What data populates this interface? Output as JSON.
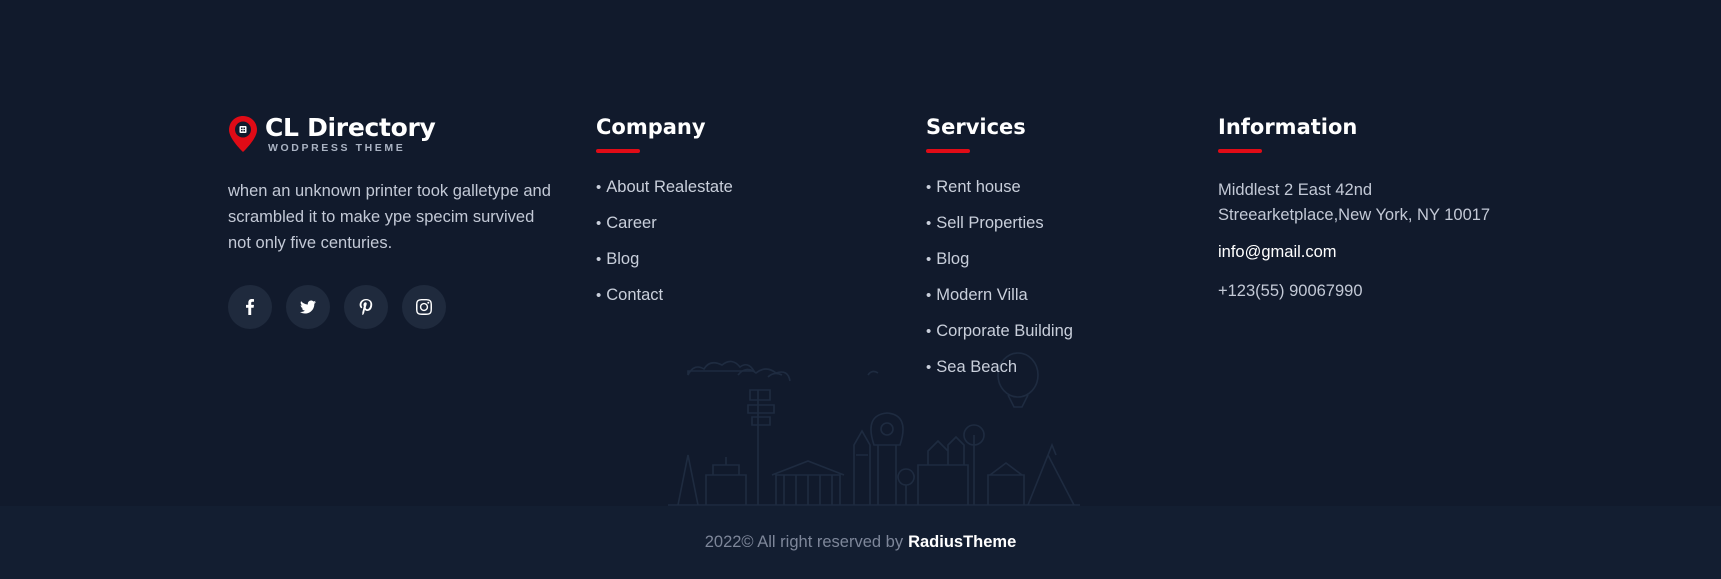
{
  "brand": {
    "title": "CL Directory",
    "subtitle": "WODPRESS THEME",
    "accent_color": "#e00b16",
    "about": "when an unknown printer took galletype and scrambled it to make ype specim survived not only five centuries."
  },
  "socials": [
    {
      "icon": "facebook-icon"
    },
    {
      "icon": "twitter-icon"
    },
    {
      "icon": "pinterest-icon"
    },
    {
      "icon": "instagram-icon"
    }
  ],
  "company": {
    "title": "Company",
    "items": [
      "About Realestate",
      "Career",
      "Blog",
      "Contact"
    ]
  },
  "services": {
    "title": "Services",
    "items": [
      "Rent house",
      "Sell Properties",
      "Blog",
      "Modern Villa",
      "Corporate Building",
      "Sea Beach"
    ]
  },
  "information": {
    "title": "Information",
    "address_line1": "Middlest 2 East 42nd",
    "address_line2": "Streearketplace,New York, NY 10017",
    "email": "info@gmail.com",
    "phone": "+123(55) 90067990"
  },
  "bottom": {
    "copyright": "2022© All right reserved by",
    "brand_link": "RadiusTheme"
  },
  "colors": {
    "background": "#111a2c",
    "bottom_bar": "#131e31",
    "social_bg": "#1f2a3d"
  }
}
